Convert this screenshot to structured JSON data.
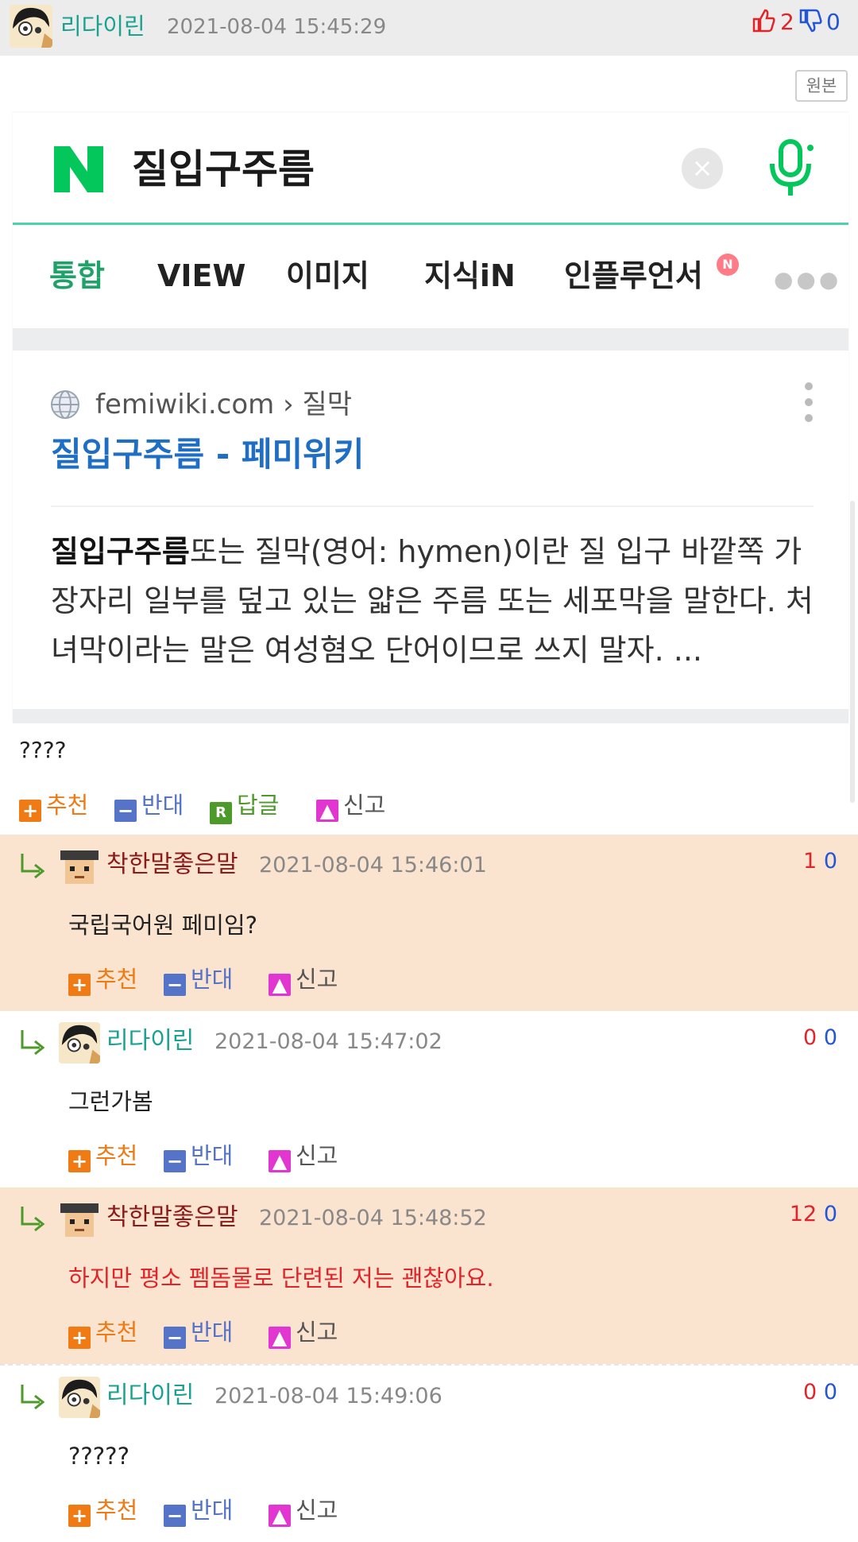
{
  "post": {
    "author": "리다이린",
    "date": "2021-08-04 15:45:29",
    "up_count": "2",
    "down_count": "0",
    "original_button": "원본",
    "text": "????"
  },
  "embed": {
    "query": "질입구주름",
    "tabs": [
      "통합",
      "VIEW",
      "이미지",
      "지식iN",
      "인플루언서"
    ],
    "tab_badge": "N",
    "result": {
      "site": "femiwiki.com",
      "breadcrumb": "› 질막",
      "title": "질입구주름 - 페미위키",
      "snippet_bold": "질입구주름",
      "snippet_rest": "또는 질막(영어: hymen)이란 질 입구 바깥쪽 가장자리 일부를 덮고 있는 얇은 주름 또는 세포막을 말한다. 처녀막이라는 말은 여성혐오 단어이므로 쓰지 말자. ..."
    },
    "colors": {
      "naver_green": "#03c75a",
      "link_blue": "#1e6ec6"
    }
  },
  "actions": {
    "recommend": "추천",
    "oppose": "반대",
    "reply": "답글",
    "report": "신고"
  },
  "comments": [
    {
      "author": "착한말좋은말",
      "date": "2021-08-04 15:46:01",
      "up": "1",
      "down": "0",
      "text": "국립국어원 페미임?"
    },
    {
      "author": "리다이린",
      "date": "2021-08-04 15:47:02",
      "up": "0",
      "down": "0",
      "text": "그런가봄"
    },
    {
      "author": "착한말좋은말",
      "date": "2021-08-04 15:48:52",
      "up": "12",
      "down": "0",
      "text": "하지만 평소 펨돔물로 단련된 저는 괜찮아요."
    },
    {
      "author": "리다이린",
      "date": "2021-08-04 15:49:06",
      "up": "0",
      "down": "0",
      "text": "?????"
    }
  ]
}
